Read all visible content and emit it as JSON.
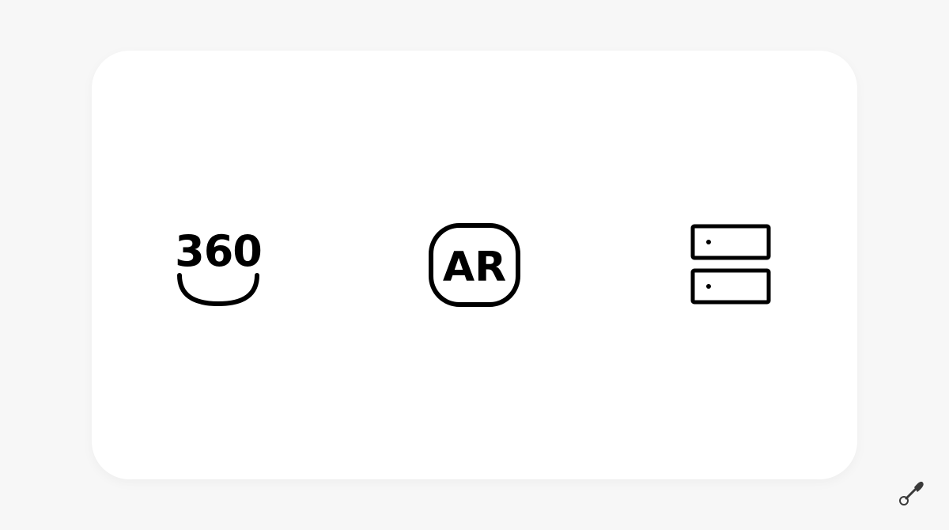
{
  "icons": [
    {
      "name": "360-view-icon",
      "label": "360"
    },
    {
      "name": "augmented-reality-icon",
      "label": "AR"
    },
    {
      "name": "server-icon"
    }
  ],
  "brand": {
    "icon": "paint-brush-icon"
  },
  "colors": {
    "background": "#f7f7f7",
    "card": "#ffffff",
    "icon_stroke": "#000000",
    "brand_mark": "#3a3a3a"
  }
}
